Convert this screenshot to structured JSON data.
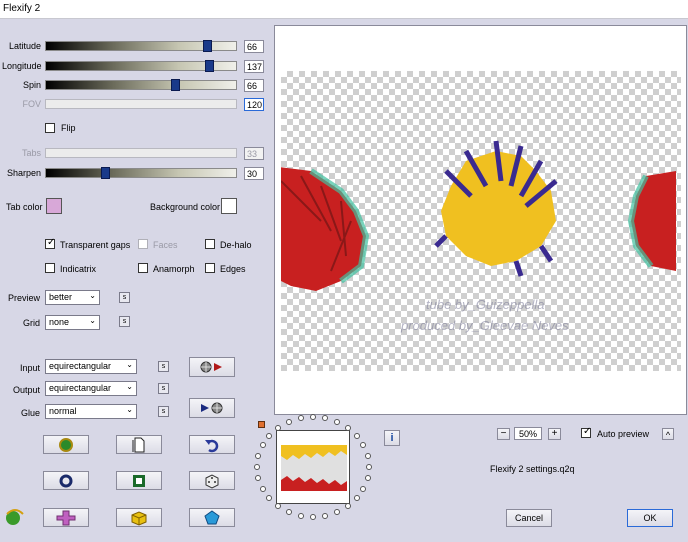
{
  "window": {
    "title": "Flexify 2"
  },
  "sliders": {
    "latitude": {
      "label": "Latitude",
      "value": "66",
      "level": 0.86
    },
    "longitude": {
      "label": "Longitude",
      "value": "137",
      "level": 0.87
    },
    "spin": {
      "label": "Spin",
      "value": "66",
      "level": 0.69
    },
    "fov": {
      "label": "FOV",
      "value": "120"
    },
    "tabs": {
      "label": "Tabs",
      "value": "33"
    },
    "sharpen": {
      "label": "Sharpen",
      "value": "30",
      "level": 0.31
    }
  },
  "checkboxes": {
    "flip": {
      "label": "Flip",
      "checked": false
    },
    "transparent_gaps": {
      "label": "Transparent gaps",
      "checked": true
    },
    "faces": {
      "label": "Faces",
      "checked": false
    },
    "de_halo": {
      "label": "De-halo",
      "checked": false
    },
    "indicatrix": {
      "label": "Indicatrix",
      "checked": false
    },
    "anamorph": {
      "label": "Anamorph",
      "checked": false
    },
    "edges": {
      "label": "Edges",
      "checked": false
    },
    "auto_preview": {
      "label": "Auto preview",
      "checked": true
    }
  },
  "colors": {
    "tab_color": {
      "label": "Tab color",
      "value": "#d8a8d8"
    },
    "background_color": {
      "label": "Background color",
      "value": "#ffffff"
    },
    "accent": "#2a6ad8"
  },
  "options": {
    "preview": {
      "label": "Preview",
      "value": "better"
    },
    "grid": {
      "label": "Grid",
      "value": "none"
    },
    "input": {
      "label": "Input",
      "value": "equirectangular"
    },
    "output": {
      "label": "Output",
      "value": "equirectangular"
    },
    "glue": {
      "label": "Glue",
      "value": "normal"
    }
  },
  "small_button_label": "s",
  "preview": {
    "watermark_line1": "tube by_Guizeppella",
    "watermark_line2": "produced by_Gleevae Neves"
  },
  "zoom": {
    "value": "50%",
    "minus": "−",
    "plus": "+"
  },
  "info_icon": "i",
  "expand_icon": "^",
  "settings_file": "Flexify 2 settings.q2q",
  "buttons": {
    "cancel": "Cancel",
    "ok": "OK"
  }
}
